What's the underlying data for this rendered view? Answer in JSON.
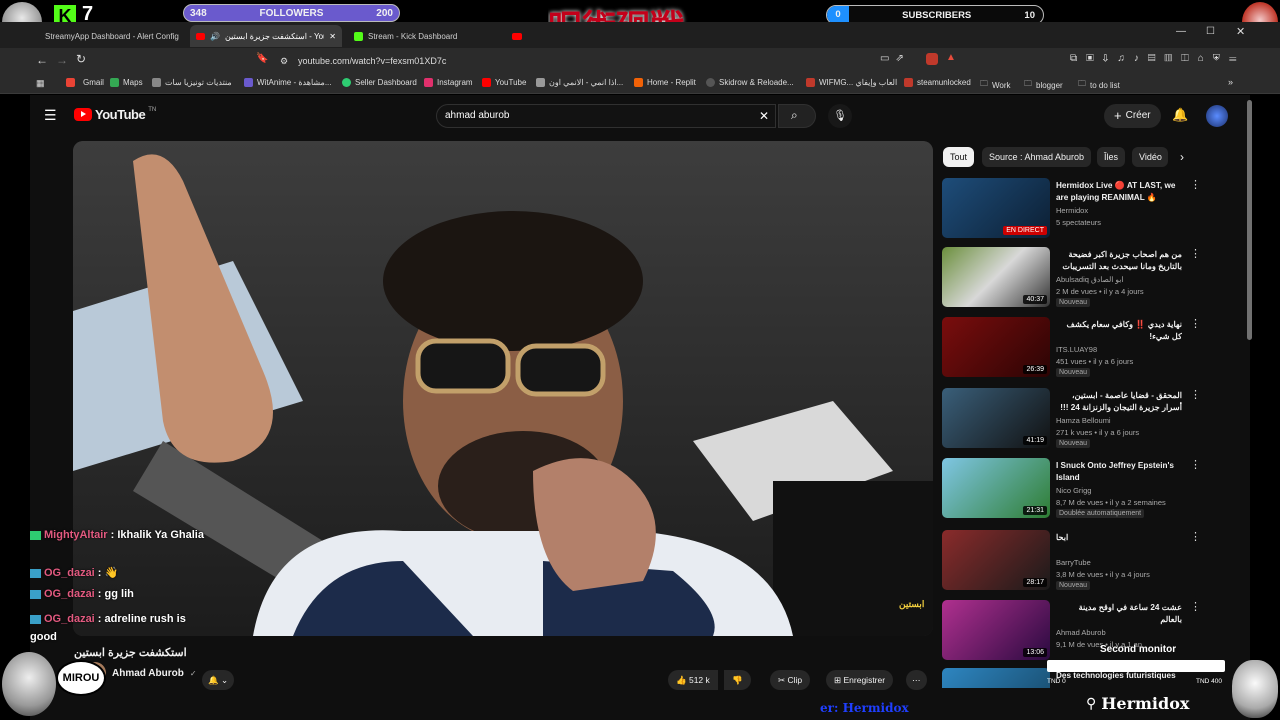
{
  "stream_overlay": {
    "kick_count": "7",
    "followers_left": "348",
    "followers_label": "FOLLOWERS",
    "followers_right": "200",
    "subscribers_left": "0",
    "subscribers_label": "SUBSCRIBERS",
    "subscribers_right": "10",
    "banner_text": "呪術廻戦",
    "second_monitor": "Second monitor",
    "brand": "Hermidox",
    "ticker_left": "TND 0",
    "ticker_right": "TND 400",
    "bottom_tag": "er: Hermidox",
    "avatar_text": "MIROU"
  },
  "tabs": [
    {
      "label": "StreamyApp Dashboard - Alert Config"
    },
    {
      "label": "استكشفت جزيرة ابستين - YouTube"
    },
    {
      "label": "Stream - Kick Dashboard"
    }
  ],
  "address_bar": {
    "url": "youtube.com/watch?v=fexsm01XD7c"
  },
  "bookmarks": [
    {
      "label": "Gmail",
      "color": "#ea4335"
    },
    {
      "label": "Maps",
      "color": "#34a853"
    },
    {
      "label": "منتديات تونيزيا سات",
      "color": "#888888"
    },
    {
      "label": "WitAnime - مشاهدة...",
      "color": "#6a5acd"
    },
    {
      "label": "Seller Dashboard",
      "color": "#2ecc71"
    },
    {
      "label": "Instagram",
      "color": "#e1306c"
    },
    {
      "label": "YouTube",
      "color": "#ff0000"
    },
    {
      "label": "اذا انمي - الانمي اون...",
      "color": "#999999"
    },
    {
      "label": "Home - Replit",
      "color": "#f26207"
    },
    {
      "label": "Skidrow & Reloade...",
      "color": "#555555"
    },
    {
      "label": "WIFMG... العاب وإيفاي",
      "color": "#c0392b"
    },
    {
      "label": "steamunlocked",
      "color": "#c0392b"
    },
    {
      "label": "Work",
      "color": "#bbbbbb"
    },
    {
      "label": "blogger",
      "color": "#bbbbbb"
    },
    {
      "label": "to do list",
      "color": "#bbbbbb"
    }
  ],
  "youtube": {
    "logo_text": "YouTube",
    "logo_sup": "TN",
    "search_value": "ahmad aburob",
    "create_label": "Créer",
    "chips": [
      "Tout",
      "Source : Ahmad Aburob",
      "Îles",
      "Vidéo"
    ],
    "video_title": "استكشفت جزيرة ابستين",
    "channel": "Ahmad Aburob",
    "like_count": "512 k",
    "clip_label": "Clip",
    "save_label": "Enregistrer",
    "video_caption": "ابستين",
    "recommendations": [
      {
        "title": "Hermidox Live 🔴 AT LAST, we are playing REANIMAL 🔥",
        "channel": "Hermidox",
        "meta": "5 spectateurs",
        "badge": "",
        "duration": "EN DIRECT",
        "live": true
      },
      {
        "title": "من هم اصحاب جزيرة اكبر فضيحة بالتاريخ ومانا سيحدث بعد التسريبات",
        "channel": "Abulsadiq ابو الصادق",
        "meta": "2 M de vues • il y a 4 jours",
        "badge": "Nouveau",
        "duration": "40:37",
        "live": false
      },
      {
        "title": "نهاية ديدي ‼️ وكافي سعام يكشف كل شيء!",
        "channel": "ITS.LUAY98",
        "meta": "451 vues • il y a 6 jours",
        "badge": "Nouveau",
        "duration": "26:39",
        "live": false
      },
      {
        "title": "المحقق - قضايا عاصمة - ابستين، أسرار جزيرة التيجان والزنزانة 24 !!!",
        "channel": "Hamza Belloumi",
        "meta": "271 k vues • il y a 6 jours",
        "badge": "Nouveau",
        "duration": "41:19",
        "live": false
      },
      {
        "title": "I Snuck Onto Jeffrey Epstein's Island",
        "channel": "Nico Grigg",
        "meta": "8,7 M de vues • il y a 2 semaines",
        "badge": "Doublée automatiquement",
        "duration": "21:31",
        "live": false
      },
      {
        "title": "ابحا",
        "channel": "BarryTube",
        "meta": "3,8 M de vues • il y a 4 jours",
        "badge": "Nouveau",
        "duration": "28:17",
        "live": false
      },
      {
        "title": "عشت 24 ساعة في اوقح مدينة بالعالم",
        "channel": "Ahmad Aburob",
        "meta": "9,1 M de vues • il y a 1 an",
        "badge": "",
        "duration": "13:06",
        "live": false
      },
      {
        "title": "Des technologies futuristiques",
        "channel": "",
        "meta": "",
        "badge": "",
        "duration": "",
        "live": false
      }
    ]
  },
  "chat": [
    {
      "user": "MightyAltair",
      "text": "Ikhalik Ya Ghalia"
    },
    {
      "user": "OG_dazai",
      "text": "👋"
    },
    {
      "user": "OG_dazai",
      "text": "gg lih"
    },
    {
      "user": "OG_dazai",
      "text": "adreline rush is good"
    }
  ],
  "colors": {
    "youtube_bg": "#0f0f0f",
    "youtube_red": "#ff0000",
    "followers_bar": "#6a5acd",
    "kick_green": "#53fc18",
    "banner_red": "#c4001a",
    "chat_user": "#e35a80"
  }
}
